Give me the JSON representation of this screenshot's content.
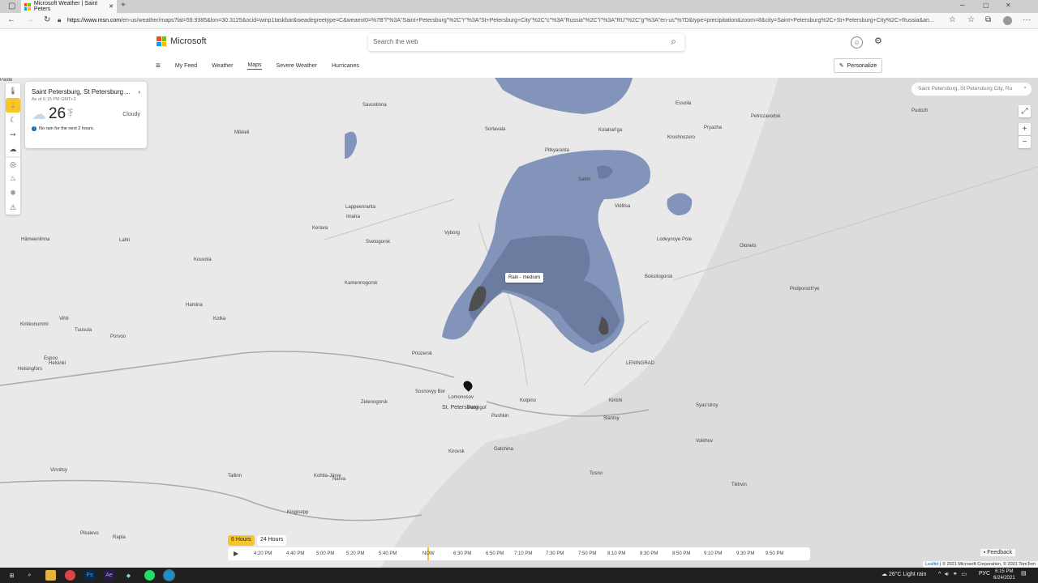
{
  "browser": {
    "tab_title": "Microsoft Weather | Saint Peters",
    "url_host": "https://www.msn.com",
    "url_rest": "/en-us/weather/maps?lat=59.9385&lon=30.3125&ocid=winp1taskbar&weadegreetype=C&weaext0=%7B\"l\"%3A\"Saint+Petersburg\"%2C\"r\"%3A\"St+Petersburg+City\"%2C\"c\"%3A\"Russia\"%2C\"i\"%3A\"RU\"%2C\"g\"%3A\"en-us\"%7D&type=precipitation&zoom=8&city=Saint+Petersburg%2C+St+Petersburg+City%2C+Russia&an..."
  },
  "header": {
    "brand": "Microsoft",
    "search_placeholder": "Search the web",
    "nav": [
      "My Feed",
      "Weather",
      "Maps",
      "Severe Weather",
      "Hurricanes"
    ],
    "personalize": "Personalize"
  },
  "weather_card": {
    "location": "Saint Petersburg, St Petersburg ...",
    "as_of": "As of 6:15 PM GMT+3",
    "temp": "26",
    "unit_c": "°C",
    "unit_f": "°F",
    "condition": "Cloudy",
    "alert": "No rain for the next 2 hours."
  },
  "map": {
    "search_placeholder": "Saint Petersburg, St Petersburg City, Ru",
    "popup": "Rain - medium",
    "zoom_in": "+",
    "zoom_out": "−",
    "labels": [
      "Savonlinna",
      "Mikkeli",
      "Sortavala",
      "Pitkyaranta",
      "Kolatsel'ga",
      "Essoila",
      "Petrozavodsk",
      "Pudozh",
      "Kroshnozero",
      "Pryazha",
      "Salmi",
      "Vidlitsa",
      "Lahti",
      "Hämeenlinna",
      "Kouvola",
      "Kotka",
      "Hamina",
      "Porvoo",
      "Espoo",
      "Helsinki",
      "Helsingfors",
      "Kirkkonummi",
      "Vihti",
      "Tuusula",
      "Kerava",
      "Lappeenranta",
      "Imatra",
      "Svetogorsk",
      "Kamennogorsk",
      "Vyborg",
      "Priozersk",
      "Zelenogorsk",
      "Sosnovyy Bor",
      "Lomonosov",
      "St. Petersburg",
      "Petergof",
      "Pushkin",
      "Kolpino",
      "Kirovsk",
      "Gatchina",
      "Tosno",
      "Kirishi",
      "Volkhov",
      "Tikhvin",
      "Boksitogorsk",
      "Lodeynoye Pole",
      "Olonets",
      "Podporozh'ye",
      "Vinnitsy",
      "Tallinn",
      "Kohtla-Järve",
      "Narva",
      "Kingisepp",
      "Slantsy",
      "LENINGRAD",
      "Syas'stroy",
      "Pikalevo",
      "Rapla",
      "Paide"
    ]
  },
  "timeline": {
    "tab_6h": "6 Hours",
    "tab_24h": "24 Hours",
    "times": [
      "4:20 PM",
      "4:40 PM",
      "5:00 PM",
      "5:20 PM",
      "5:40 PM",
      "NOW",
      "6:30 PM",
      "6:50 PM",
      "7:10 PM",
      "7:30 PM",
      "7:50 PM",
      "8:10 PM",
      "8:30 PM",
      "8:50 PM",
      "9:10 PM",
      "9:30 PM",
      "9:50 PM"
    ]
  },
  "feedback": "Feedback",
  "attribution": {
    "leaflet": "Leaflet",
    "text": "| © 2021 Microsoft Corporation, © 2021 TomTom"
  },
  "taskbar": {
    "weather": "26°C  Light rain",
    "lang": "РУС",
    "time": "6:15 PM",
    "date": "6/24/2021"
  }
}
